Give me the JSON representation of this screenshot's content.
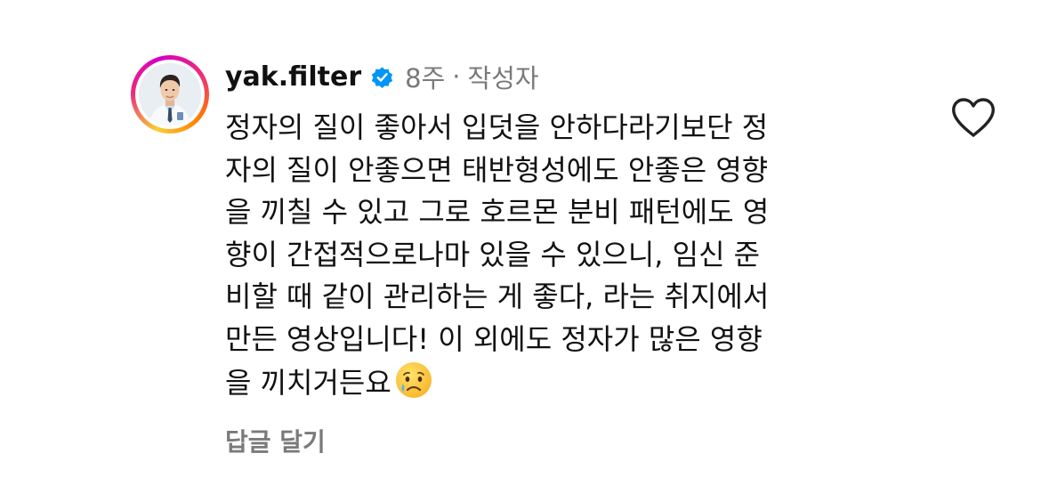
{
  "comment": {
    "username": "yak.filter",
    "time": "8주",
    "separator": "·",
    "role_badge": "작성자",
    "lines": [
      "정자의 질이 좋아서 입덧을 안하다라기보단 정",
      "자의 질이 안좋으면 태반형성에도 안좋은 영향",
      "을 끼칠 수 있고 그로 호르몬 분비 패턴에도 영",
      "향이 간접적으로나마 있을 수 있으니, 임신 준",
      "비할 때 같이 관리하는 게 좋다, 라는 취지에서",
      "만든 영상입니다! 이 외에도 정자가 많은 영향",
      "을 끼치거든요"
    ],
    "emoji": "crying-face",
    "reply_label": "답글 달기"
  },
  "icons": {
    "verified": "verified-badge-icon",
    "like": "heart-outline-icon"
  },
  "colors": {
    "verified_blue": "#0095F6",
    "meta_gray": "#7A7A7A",
    "text": "#111111"
  }
}
